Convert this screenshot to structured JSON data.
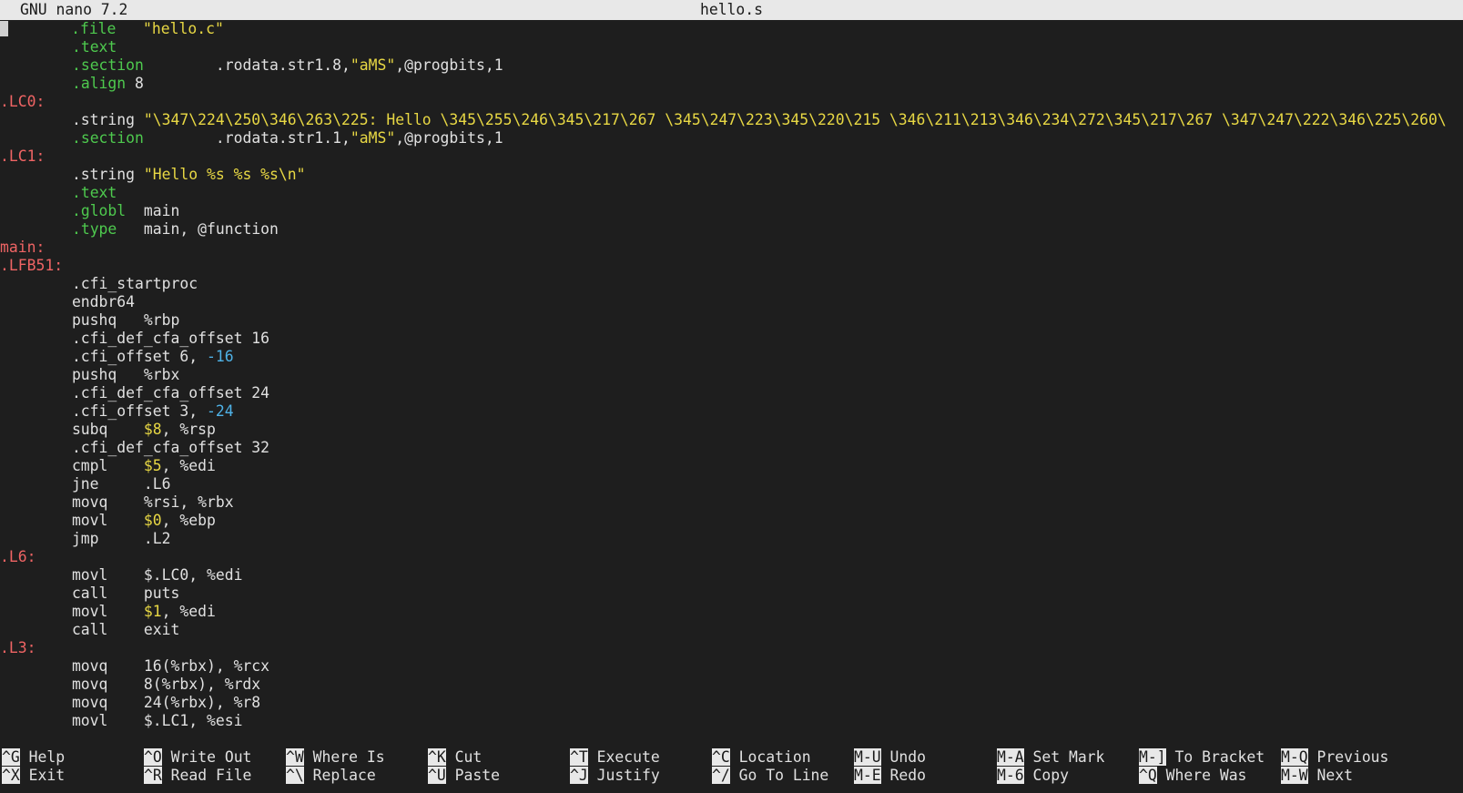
{
  "titlebar": {
    "app": "GNU nano 7.2",
    "filename": "hello.s"
  },
  "code_lines": [
    [
      {
        "t": "cursor"
      },
      {
        "t": "       "
      },
      {
        "t": ".file",
        "c": "dir"
      },
      {
        "t": "   "
      },
      {
        "t": "\"hello.c\"",
        "c": "str"
      }
    ],
    [
      {
        "t": "        "
      },
      {
        "t": ".text",
        "c": "dir"
      }
    ],
    [
      {
        "t": "        "
      },
      {
        "t": ".section",
        "c": "dir"
      },
      {
        "t": "        .rodata.str1.8,"
      },
      {
        "t": "\"aMS\"",
        "c": "str"
      },
      {
        "t": ",@progbits,1"
      }
    ],
    [
      {
        "t": "        "
      },
      {
        "t": ".align",
        "c": "dir"
      },
      {
        "t": " 8"
      }
    ],
    [
      {
        "t": ".LC0:",
        "c": "label"
      }
    ],
    [
      {
        "t": "        .string "
      },
      {
        "t": "\"\\347\\224\\250\\346\\263\\225: Hello \\345\\255\\246\\345\\217\\267 \\345\\247\\223\\345\\220\\215 \\346\\211\\213\\346\\234\\272\\345\\217\\267 \\347\\247\\222\\346\\225\\260\\",
        "c": "str"
      }
    ],
    [
      {
        "t": "        "
      },
      {
        "t": ".section",
        "c": "dir"
      },
      {
        "t": "        .rodata.str1.1,"
      },
      {
        "t": "\"aMS\"",
        "c": "str"
      },
      {
        "t": ",@progbits,1"
      }
    ],
    [
      {
        "t": ".LC1:",
        "c": "label"
      }
    ],
    [
      {
        "t": "        .string "
      },
      {
        "t": "\"Hello %s %s %s\\n\"",
        "c": "str"
      }
    ],
    [
      {
        "t": "        "
      },
      {
        "t": ".text",
        "c": "dir"
      }
    ],
    [
      {
        "t": "        "
      },
      {
        "t": ".globl",
        "c": "dir"
      },
      {
        "t": "  main"
      }
    ],
    [
      {
        "t": "        "
      },
      {
        "t": ".type",
        "c": "dir"
      },
      {
        "t": "   main, @function"
      }
    ],
    [
      {
        "t": "main:",
        "c": "label"
      }
    ],
    [
      {
        "t": ".LFB51:",
        "c": "label"
      }
    ],
    [
      {
        "t": "        .cfi_startproc"
      }
    ],
    [
      {
        "t": "        endbr64"
      }
    ],
    [
      {
        "t": "        pushq   %rbp"
      }
    ],
    [
      {
        "t": "        .cfi_def_cfa_offset 16"
      }
    ],
    [
      {
        "t": "        .cfi_offset 6, "
      },
      {
        "t": "-16",
        "c": "num"
      }
    ],
    [
      {
        "t": "        pushq   %rbx"
      }
    ],
    [
      {
        "t": "        .cfi_def_cfa_offset 24"
      }
    ],
    [
      {
        "t": "        .cfi_offset 3, "
      },
      {
        "t": "-24",
        "c": "num"
      }
    ],
    [
      {
        "t": "        subq    "
      },
      {
        "t": "$8",
        "c": "imm"
      },
      {
        "t": ", %rsp"
      }
    ],
    [
      {
        "t": "        .cfi_def_cfa_offset 32"
      }
    ],
    [
      {
        "t": "        cmpl    "
      },
      {
        "t": "$5",
        "c": "imm"
      },
      {
        "t": ", %edi"
      }
    ],
    [
      {
        "t": "        jne     .L6"
      }
    ],
    [
      {
        "t": "        movq    %rsi, %rbx"
      }
    ],
    [
      {
        "t": "        movl    "
      },
      {
        "t": "$0",
        "c": "imm"
      },
      {
        "t": ", %ebp"
      }
    ],
    [
      {
        "t": "        jmp     .L2"
      }
    ],
    [
      {
        "t": ".L6:",
        "c": "label"
      }
    ],
    [
      {
        "t": "        movl    $.LC0, %edi"
      }
    ],
    [
      {
        "t": "        call    puts"
      }
    ],
    [
      {
        "t": "        movl    "
      },
      {
        "t": "$1",
        "c": "imm"
      },
      {
        "t": ", %edi"
      }
    ],
    [
      {
        "t": "        call    exit"
      }
    ],
    [
      {
        "t": ".L3:",
        "c": "label"
      }
    ],
    [
      {
        "t": "        movq    16(%rbx), %rcx"
      }
    ],
    [
      {
        "t": "        movq    8(%rbx), %rdx"
      }
    ],
    [
      {
        "t": "        movq    24(%rbx), %r8"
      }
    ],
    [
      {
        "t": "        movl    $.LC1, %esi"
      }
    ]
  ],
  "shortcuts": [
    {
      "key": "^G",
      "label": "Help"
    },
    {
      "key": "^O",
      "label": "Write Out"
    },
    {
      "key": "^W",
      "label": "Where Is"
    },
    {
      "key": "^K",
      "label": "Cut"
    },
    {
      "key": "^T",
      "label": "Execute"
    },
    {
      "key": "^C",
      "label": "Location"
    },
    {
      "key": "M-U",
      "label": "Undo"
    },
    {
      "key": "M-A",
      "label": "Set Mark"
    },
    {
      "key": "M-]",
      "label": "To Bracket"
    },
    {
      "key": "M-Q",
      "label": "Previous"
    },
    {
      "key": "^X",
      "label": "Exit"
    },
    {
      "key": "^R",
      "label": "Read File"
    },
    {
      "key": "^\\",
      "label": "Replace"
    },
    {
      "key": "^U",
      "label": "Paste"
    },
    {
      "key": "^J",
      "label": "Justify"
    },
    {
      "key": "^/",
      "label": "Go To Line"
    },
    {
      "key": "M-E",
      "label": "Redo"
    },
    {
      "key": "M-6",
      "label": "Copy"
    },
    {
      "key": "^Q",
      "label": "Where Was"
    },
    {
      "key": "M-W",
      "label": "Next"
    }
  ]
}
